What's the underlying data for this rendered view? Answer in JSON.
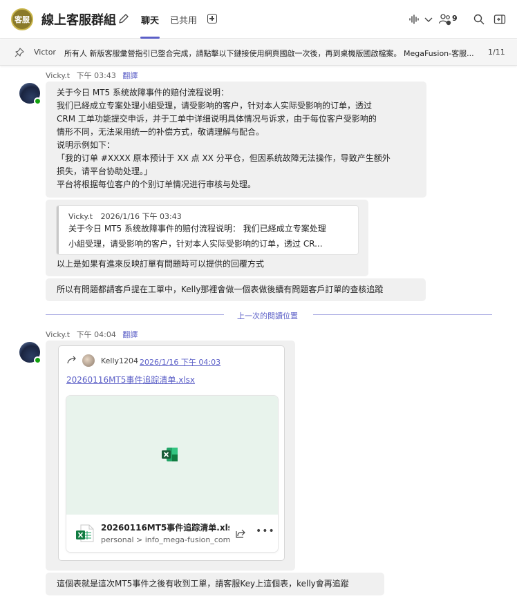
{
  "header": {
    "group_avatar_text": "客服",
    "title": "線上客服群組",
    "tabs": [
      {
        "label": "聊天",
        "active": true
      },
      {
        "label": "已共用",
        "active": false
      }
    ],
    "participants_count": "9",
    "accent_color": "#5b5fc7"
  },
  "pinned": {
    "author": "Victor",
    "text": "所有人 新版客服彙營指引已整合完成，請點擊以下鏈接使用網頁國啟一次後，再到桌機版國啟檔案。 MegaFusion-客服...",
    "count": "1/11"
  },
  "translate_label": "翻譯",
  "messages": [
    {
      "author": "Vicky.t",
      "time": "下午 03:43",
      "bubbles": [
        {
          "lines": [
            "关于今日 MT5 系统故障事件的赔付流程说明：",
            "我们已経成立专案处理小組受理，请受影响的客户，针对本人实际受影响的订单，透过",
            "CRM 工单功能提交申诉，并于工单中详细说明具体情况与诉求，由于每位客户受影响的",
            "情形不同，无法采用统一的补偿方式，敬请理解与配合。",
            "说明示例如下：",
            "「我的订单 #XXXX 原本预计于 XX 点 XX 分平仓，但因系统故障无法操作，导致产生额外",
            "损失，请平台协助处理。」",
            "平台将根据每位客户的个别订单情况进行审核与处理。"
          ]
        },
        {
          "quote": {
            "author": "Vicky.t",
            "time": "2026/1/16 下午 03:43",
            "lines": [
              "关于今日 MT5 系统故障事件的赔付流程说明： 我们已経成立专案处理",
              "小組受理，请受影响的客户，针对本人实际受影响的订单，透过 CR..."
            ]
          },
          "text": "以上是如果有進來反映訂單有問題時可以提供的回覆方式"
        },
        {
          "text": "所以有問題都請客戶提在工單中，Kelly那裡會做一個表做後續有問題客戶訂單的查核追蹤"
        }
      ]
    },
    {
      "author": "Vicky.t",
      "time": "下午 04:04",
      "forward": {
        "author": "Kelly1204",
        "date": "2026/1/16 下午 04:03",
        "link": "20260116MT5事件追踪清单.xlsx",
        "file_name": "20260116MT5事件追踪清单.xlsx",
        "file_path": "personal > info_mega-fusion_com"
      },
      "text": "這個表就是這次MT5事件之後有收到工單，請客服Key上這個表，kelly會再追蹤"
    }
  ],
  "divider_label": "上一次的閱讀位置"
}
